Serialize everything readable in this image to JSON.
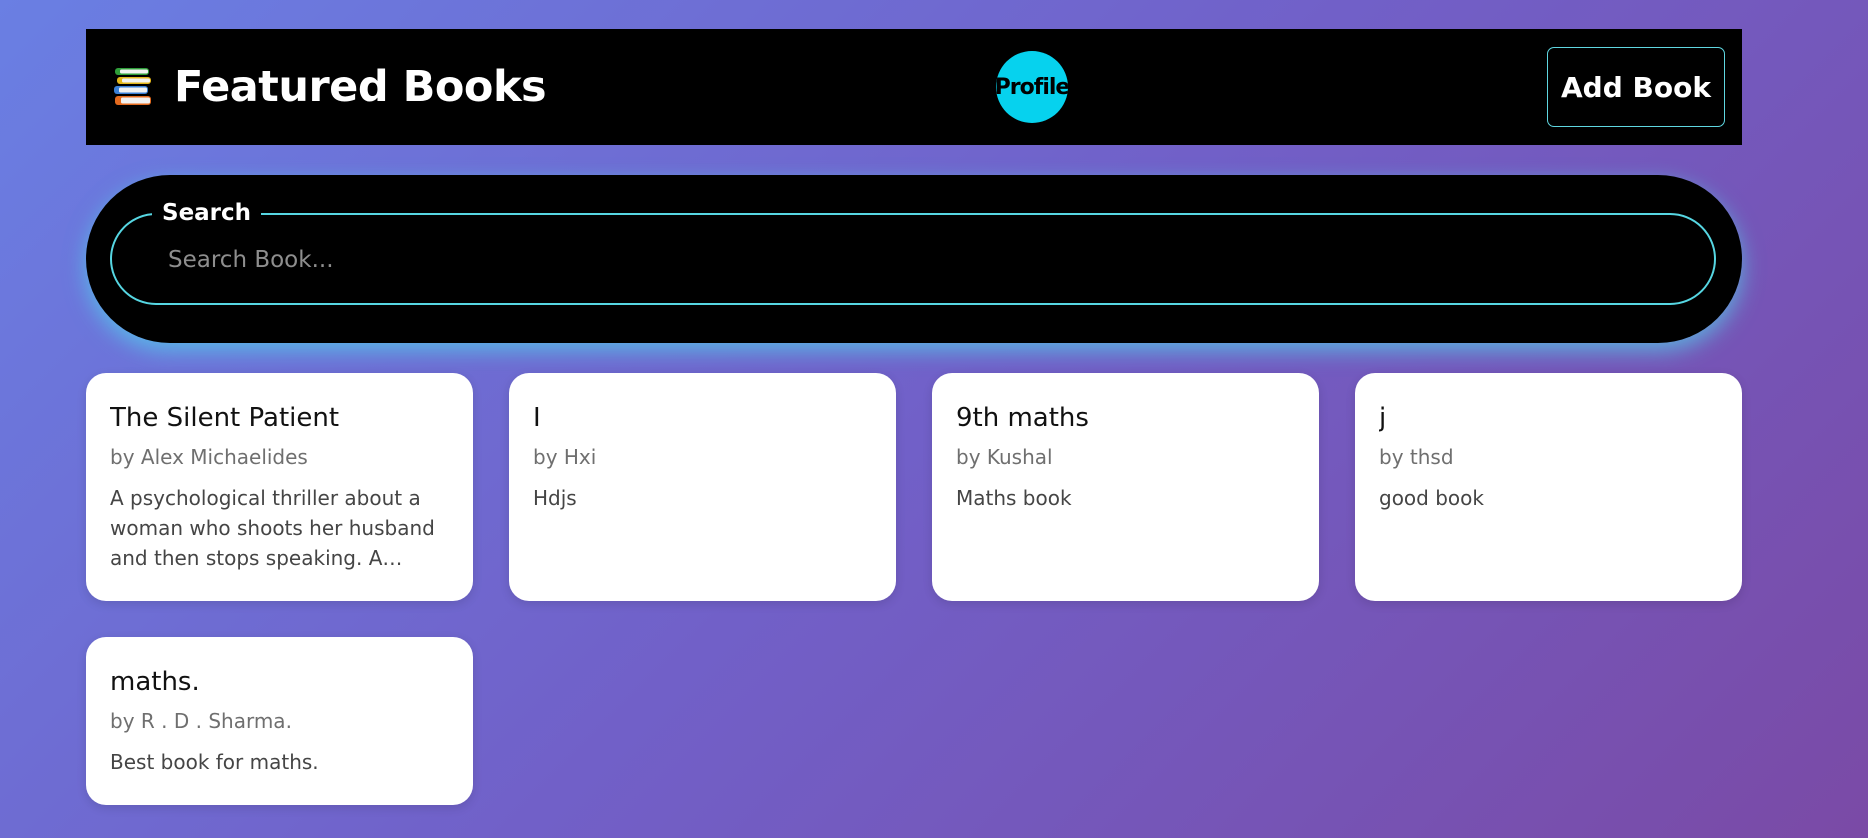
{
  "header": {
    "title": "Featured Books",
    "icon": "books-stack-icon",
    "profile_label": "Profile",
    "add_book_label": "Add Book"
  },
  "search": {
    "legend": "Search",
    "placeholder": "Search Book...",
    "value": ""
  },
  "books": [
    {
      "title": "The Silent Patient",
      "author": "by Alex Michaelides",
      "description": "A psychological thriller about a woman who shoots her husband and then stops speaking. A crimin..."
    },
    {
      "title": "I",
      "author": "by Hxi",
      "description": "Hdjs"
    },
    {
      "title": "9th maths",
      "author": "by Kushal",
      "description": "Maths book"
    },
    {
      "title": "j",
      "author": "by thsd",
      "description": "good book"
    },
    {
      "title": "maths.",
      "author": "by R . D . Sharma.",
      "description": "Best book for maths."
    }
  ],
  "colors": {
    "accent": "#06d2ee",
    "border_accent": "#56d6e2",
    "header_bg": "#000000",
    "card_bg": "#ffffff"
  }
}
